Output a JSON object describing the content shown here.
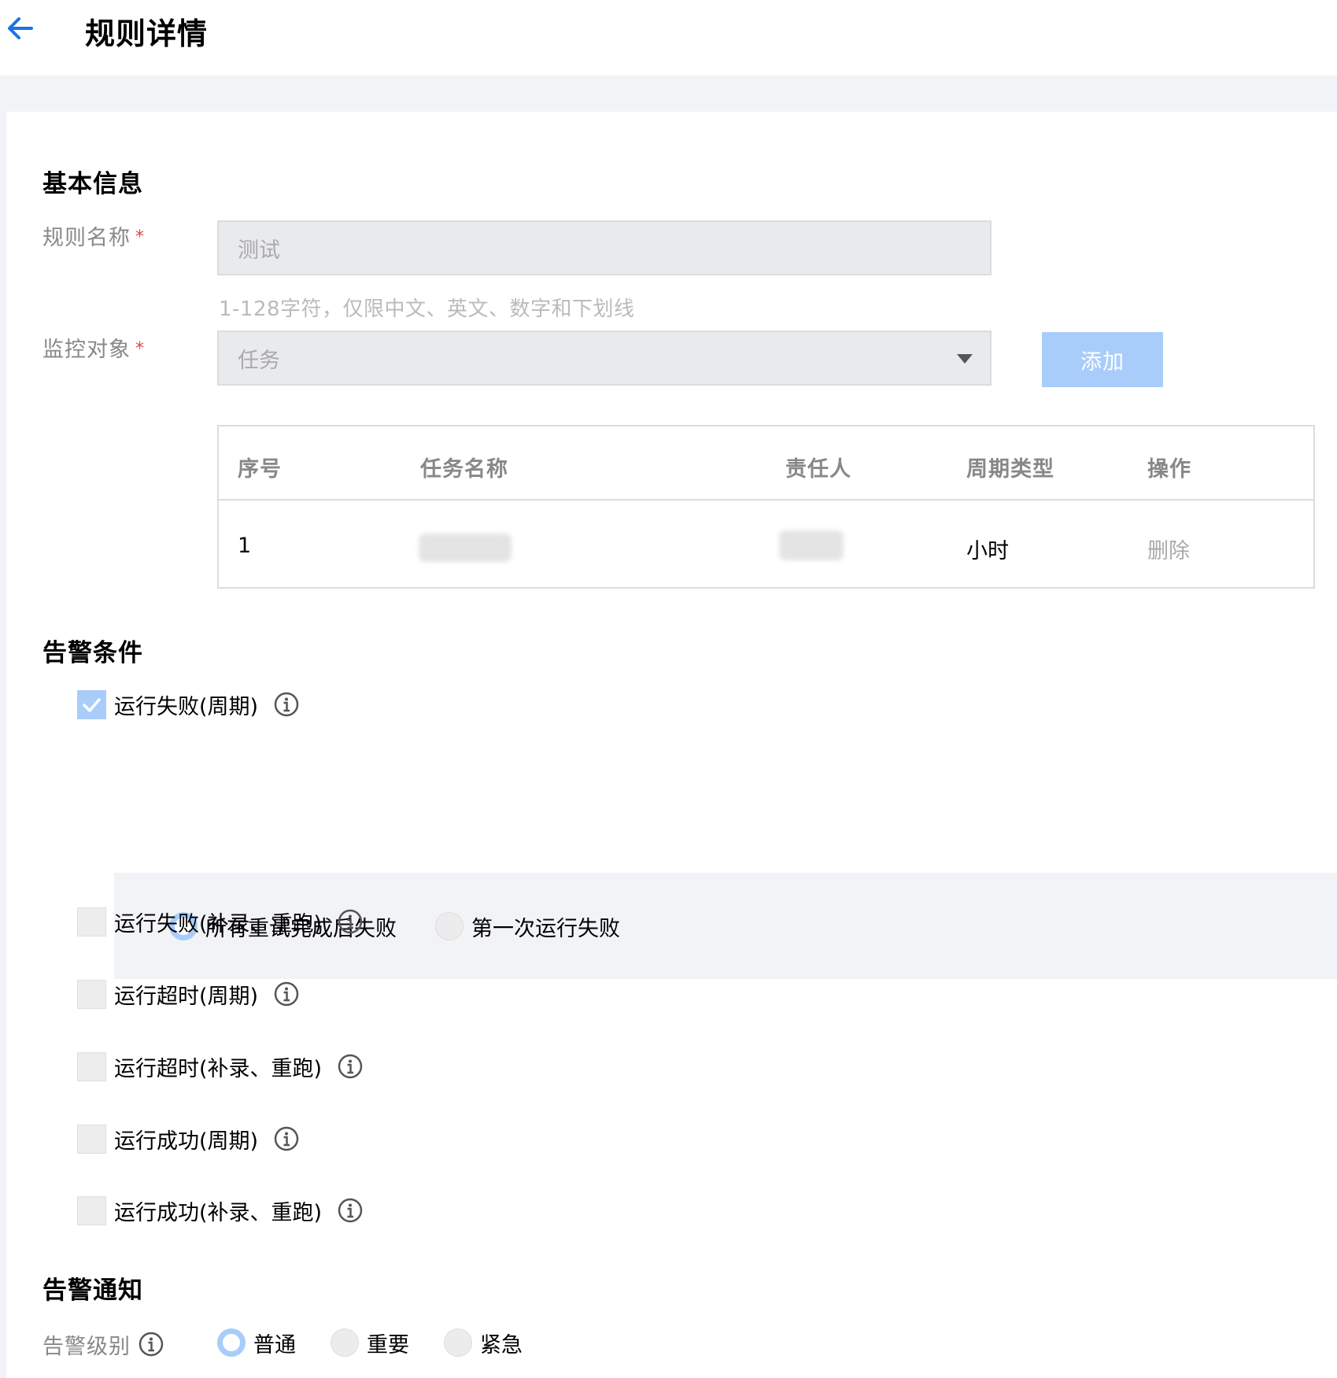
{
  "header": {
    "title": "规则详情"
  },
  "basic_info": {
    "section_title": "基本信息",
    "rule_name": {
      "label": "规则名称",
      "required_mark": "*",
      "value": "测试",
      "hint": "1-128字符，仅限中文、英文、数字和下划线"
    },
    "monitor_object": {
      "label": "监控对象",
      "required_mark": "*",
      "selected": "任务",
      "add_button": "添加"
    },
    "table": {
      "columns": [
        "序号",
        "任务名称",
        "责任人",
        "周期类型",
        "操作"
      ],
      "rows": [
        {
          "index": "1",
          "task_name": "",
          "owner": "",
          "cycle_type": "小时",
          "action": "删除"
        }
      ]
    }
  },
  "alert_conditions": {
    "section_title": "告警条件",
    "items": [
      {
        "label": "运行失败(周期)",
        "checked": true
      },
      {
        "label": "运行失败(补录、重跑)",
        "checked": false
      },
      {
        "label": "运行超时(周期)",
        "checked": false
      },
      {
        "label": "运行超时(补录、重跑)",
        "checked": false
      },
      {
        "label": "运行成功(周期)",
        "checked": false
      },
      {
        "label": "运行成功(补录、重跑)",
        "checked": false
      }
    ],
    "failure_options": [
      {
        "label": "所有重试完成后失败",
        "selected": true
      },
      {
        "label": "第一次运行失败",
        "selected": false
      }
    ]
  },
  "alert_notify": {
    "section_title": "告警通知",
    "level_label": "告警级别",
    "levels": [
      {
        "label": "普通",
        "selected": true
      },
      {
        "label": "重要",
        "selected": false
      },
      {
        "label": "紧急",
        "selected": false
      }
    ]
  },
  "colors": {
    "accent": "#1a73e8",
    "disabled_primary": "#a9cdfa",
    "required": "#e54545",
    "muted_text": "#888888"
  }
}
